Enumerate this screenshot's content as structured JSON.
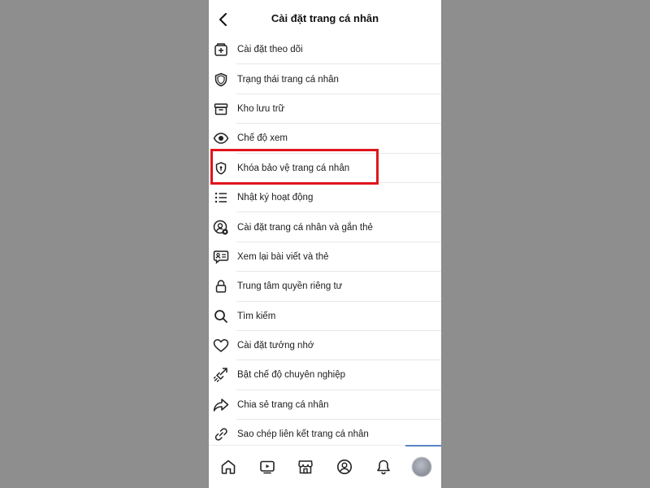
{
  "header": {
    "title": "Cài đặt trang cá nhân"
  },
  "menu": {
    "items": [
      {
        "icon": "add-follow-icon",
        "label": "Cài đặt theo dõi"
      },
      {
        "icon": "shield-icon",
        "label": "Trạng thái trang cá nhân"
      },
      {
        "icon": "archive-icon",
        "label": "Kho lưu trữ"
      },
      {
        "icon": "eye-icon",
        "label": "Chế độ xem"
      },
      {
        "icon": "shield-lock-icon",
        "label": "Khóa bảo vệ trang cá nhân",
        "highlighted": true
      },
      {
        "icon": "list-icon",
        "label": "Nhật ký hoạt động"
      },
      {
        "icon": "profile-settings-icon",
        "label": "Cài đặt trang cá nhân và gắn thẻ"
      },
      {
        "icon": "review-posts-icon",
        "label": "Xem lại bài viết và thẻ"
      },
      {
        "icon": "lock-icon",
        "label": "Trung tâm quyền riêng tư"
      },
      {
        "icon": "search-icon",
        "label": "Tìm kiếm"
      },
      {
        "icon": "heart-icon",
        "label": "Cài đặt tưởng nhớ"
      },
      {
        "icon": "professional-mode-icon",
        "label": "Bật chế độ chuyên nghiệp"
      },
      {
        "icon": "share-icon",
        "label": "Chia sẻ trang cá nhân"
      },
      {
        "icon": "link-icon",
        "label": "Sao chép liên kết trang cá nhân"
      }
    ]
  },
  "bottom_nav": {
    "items": [
      "home-icon",
      "video-icon",
      "marketplace-icon",
      "profile-icon",
      "bell-icon",
      "avatar"
    ],
    "active_indicator_color": "#5b86c8"
  },
  "colors": {
    "highlight_border": "#e0161d",
    "background": "#8e8e8e"
  }
}
